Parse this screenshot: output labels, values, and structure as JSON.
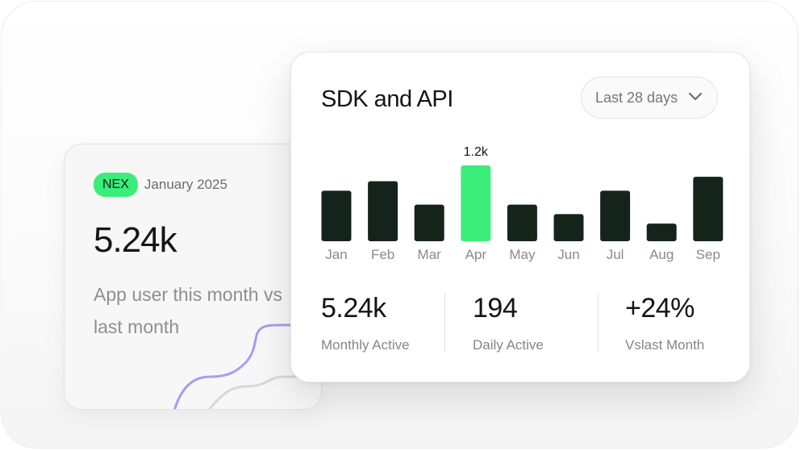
{
  "back_card": {
    "badge": "NEX",
    "period": "January 2025",
    "value": "5.24k",
    "caption": "App user this month vs last month",
    "accent_line_color": "#a79cf2",
    "secondary_line_color": "#d8d8d8"
  },
  "front_card": {
    "title": "SDK and API",
    "dropdown_label": "Last 28 days",
    "highlight_color": "#3ded7c",
    "bar_color": "#14241b"
  },
  "chart_data": {
    "type": "bar",
    "categories": [
      "Jan",
      "Feb",
      "Mar",
      "Apr",
      "May",
      "Jun",
      "Jul",
      "Aug",
      "Sep"
    ],
    "values": [
      0.8,
      0.95,
      0.58,
      1.2,
      0.58,
      0.43,
      0.8,
      0.28,
      1.02
    ],
    "highlighted_index": 3,
    "data_labels": {
      "3": "1.2k"
    },
    "grid": false
  },
  "stats": [
    {
      "value": "5.24k",
      "label": "Monthly Active"
    },
    {
      "value": "194",
      "label": "Daily Active"
    },
    {
      "value": "+24%",
      "label": "Vslast Month"
    }
  ]
}
